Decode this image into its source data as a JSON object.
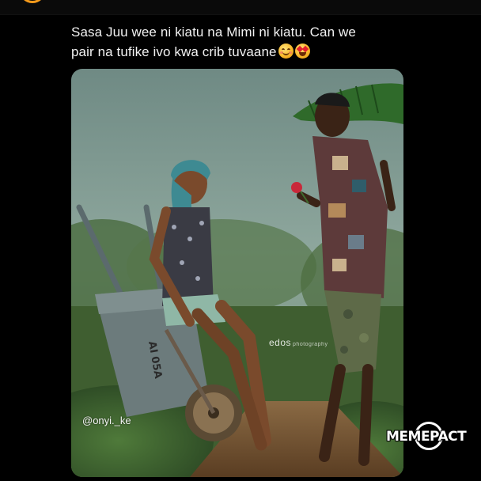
{
  "post": {
    "caption_line1": "Sasa Juu wee ni kiatu na Mimi ni kiatu. Can we",
    "caption_line2": "pair na tufike ivo kwa crib tuvaane",
    "emojis": [
      "smiling-face-with-smiling-eyes",
      "star-struck"
    ]
  },
  "photo": {
    "handle_watermark": "@onyi._ke",
    "edos_watermark": "edos",
    "edos_small": "photography",
    "wheelbarrow_text": "AI 05A"
  },
  "brand": {
    "logo_text": "MEMEPACT"
  },
  "colors": {
    "background": "#000000",
    "caption_text": "#f2f2f2",
    "avatar_ring": "#f59a1a"
  }
}
